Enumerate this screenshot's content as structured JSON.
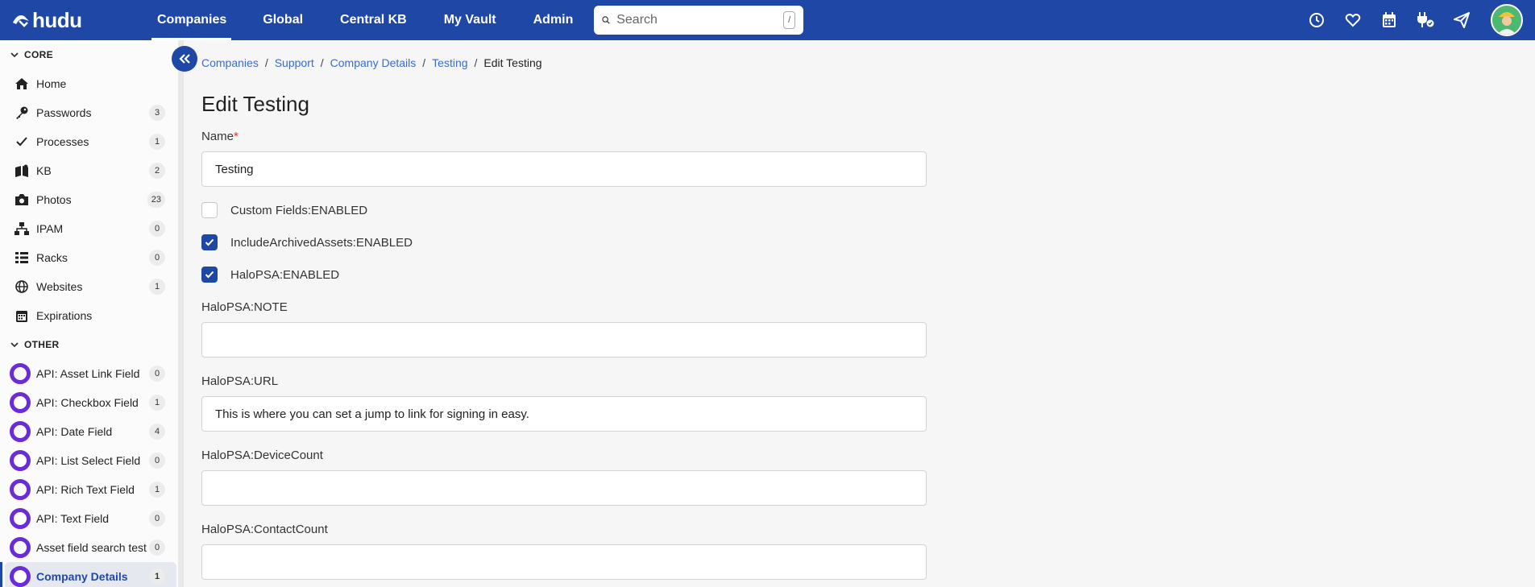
{
  "brand": {
    "name": "hudu"
  },
  "nav": {
    "items": [
      {
        "label": "Companies",
        "active": true
      },
      {
        "label": "Global"
      },
      {
        "label": "Central KB"
      },
      {
        "label": "My Vault"
      },
      {
        "label": "Admin"
      }
    ]
  },
  "search": {
    "placeholder": "Search",
    "shortcut": "/"
  },
  "top_icons": [
    "clock-icon",
    "heart-icon",
    "calendar-icon",
    "plug-icon",
    "send-icon",
    "avatar"
  ],
  "sidebar": {
    "core_label": "CORE",
    "core_items": [
      {
        "label": "Home",
        "icon": "home-icon",
        "count": ""
      },
      {
        "label": "Passwords",
        "icon": "key-icon",
        "count": "3"
      },
      {
        "label": "Processes",
        "icon": "check-icon",
        "count": "1"
      },
      {
        "label": "KB",
        "icon": "book-icon",
        "count": "2"
      },
      {
        "label": "Photos",
        "icon": "camera-icon",
        "count": "23"
      },
      {
        "label": "IPAM",
        "icon": "network-icon",
        "count": "0"
      },
      {
        "label": "Racks",
        "icon": "rack-icon",
        "count": "0"
      },
      {
        "label": "Websites",
        "icon": "globe-icon",
        "count": "1"
      },
      {
        "label": "Expirations",
        "icon": "calendar-icon",
        "count": ""
      }
    ],
    "other_label": "OTHER",
    "other_items": [
      {
        "label": "API: Asset Link Field",
        "count": "0"
      },
      {
        "label": "API: Checkbox Field",
        "count": "1"
      },
      {
        "label": "API: Date Field",
        "count": "4"
      },
      {
        "label": "API: List Select Field",
        "count": "0"
      },
      {
        "label": "API: Rich Text Field",
        "count": "1"
      },
      {
        "label": "API: Text Field",
        "count": "0"
      },
      {
        "label": "Asset field search test",
        "count": "0"
      },
      {
        "label": "Company Details",
        "count": "1",
        "active": true
      }
    ]
  },
  "breadcrumb": {
    "items": [
      "Companies",
      "Support",
      "Company Details",
      "Testing"
    ],
    "current": "Edit Testing"
  },
  "form": {
    "title": "Edit Testing",
    "name_label": "Name",
    "name_required_mark": "*",
    "name_value": "Testing",
    "checkboxes": [
      {
        "label": "Custom Fields:ENABLED",
        "checked": false
      },
      {
        "label": "IncludeArchivedAssets:ENABLED",
        "checked": true
      },
      {
        "label": "HaloPSA:ENABLED",
        "checked": true
      }
    ],
    "fields": [
      {
        "label": "HaloPSA:NOTE",
        "value": ""
      },
      {
        "label": "HaloPSA:URL",
        "value": "This is where you can set a jump to link for signing in easy."
      },
      {
        "label": "HaloPSA:DeviceCount",
        "value": ""
      },
      {
        "label": "HaloPSA:ContactCount",
        "value": ""
      }
    ]
  },
  "colors": {
    "brand_blue": "#1f48a6",
    "link": "#3a6bd1",
    "layout_ring": "#6a2cd8"
  }
}
